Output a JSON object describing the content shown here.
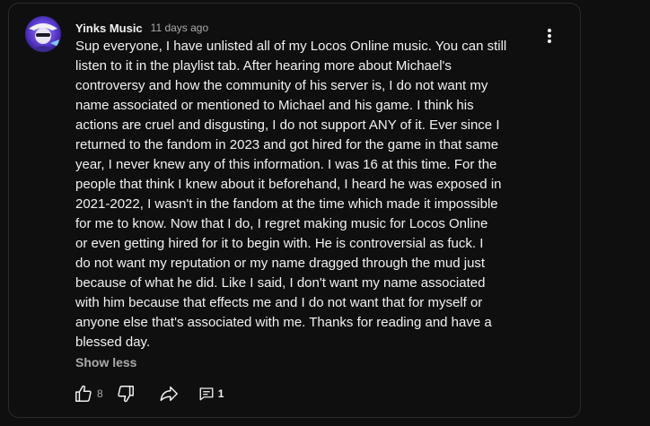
{
  "comment": {
    "author": "Yinks Music",
    "timestamp": "11 days ago",
    "text": "Sup everyone, I have unlisted all of my Locos Online music. You can still\nlisten to it in the playlist tab. After hearing more about Michael's\ncontroversy and how the community of his server is, I do not want my\nname associated or mentioned to Michael and his game. I think his\nactions are cruel and disgusting, I do not support ANY of it. Ever since I\nreturned to the fandom in 2023 and got hired for the game in that same\nyear, I never knew any of this information. I was 16 at this time. For the\npeople that think I knew about it beforehand, I heard he was exposed in\n2021-2022, I wasn't in the fandom at the time which made it impossible\nfor me to know. Now that I do, I regret making music for Locos Online\nor even getting hired for it to begin with. He is controversial as fuck. I\ndo not want my reputation or my name dragged through the mud just\nbecause of what he did. Like I said, I don't want my name associated\nwith him because that effects me and I do not want that for myself or\nanyone else that's associated with me. Thanks for reading and have a\nblessed day.",
    "show_less_label": "Show less",
    "like_count": "8",
    "reply_count": "1"
  },
  "icons": {
    "avatar": "avatar-image",
    "menu": "more-vert-icon",
    "like": "thumbs-up-icon",
    "dislike": "thumbs-down-icon",
    "share": "share-arrow-icon",
    "reply": "comment-icon"
  },
  "colors": {
    "background": "#0f0f0f",
    "text_primary": "#f1f1f1",
    "text_secondary": "#aaaaaa",
    "border": "#2a2a2a"
  }
}
